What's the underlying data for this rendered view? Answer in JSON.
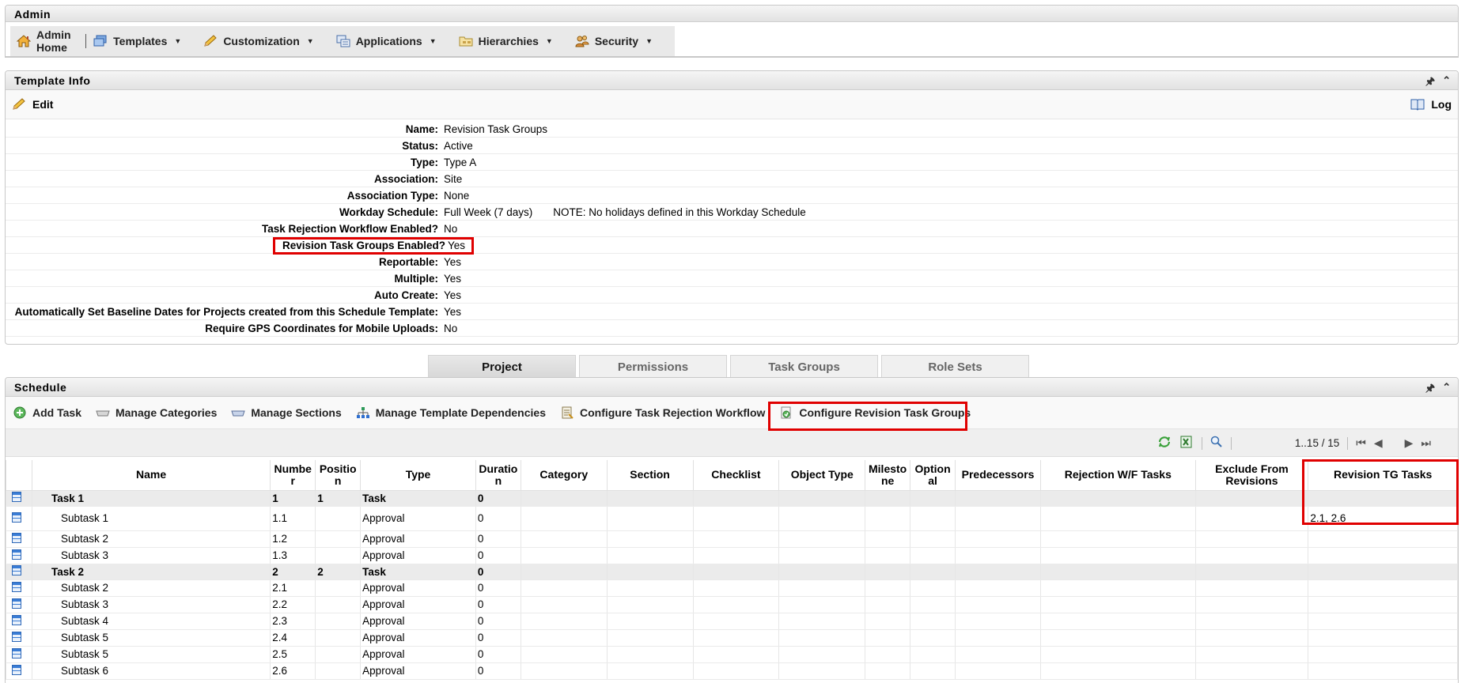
{
  "admin": {
    "title": "Admin",
    "nav": [
      {
        "label": "Admin Home",
        "icon": "house-icon",
        "dropdown": false
      },
      {
        "label": "Templates",
        "icon": "templates-icon",
        "dropdown": true
      },
      {
        "label": "Customization",
        "icon": "pencil-icon",
        "dropdown": true
      },
      {
        "label": "Applications",
        "icon": "applications-icon",
        "dropdown": true
      },
      {
        "label": "Hierarchies",
        "icon": "folder-icon",
        "dropdown": true
      },
      {
        "label": "Security",
        "icon": "users-icon",
        "dropdown": true
      }
    ]
  },
  "template_info": {
    "title": "Template Info",
    "edit_label": "Edit",
    "log_label": "Log",
    "rows": [
      {
        "label": "Name:",
        "value": "Revision Task Groups"
      },
      {
        "label": "Status:",
        "value": "Active"
      },
      {
        "label": "Type:",
        "value": "Type A"
      },
      {
        "label": "Association:",
        "value": "Site"
      },
      {
        "label": "Association Type:",
        "value": "None"
      },
      {
        "label": "Workday Schedule:",
        "value": "Full Week (7 days)",
        "note": "NOTE: No holidays defined in this Workday Schedule"
      },
      {
        "label": "Task Rejection Workflow Enabled?",
        "value": "No"
      },
      {
        "label": "Revision Task Groups Enabled?",
        "value": "Yes",
        "highlighted": true
      },
      {
        "label": "Reportable:",
        "value": "Yes"
      },
      {
        "label": "Multiple:",
        "value": "Yes"
      },
      {
        "label": "Auto Create:",
        "value": "Yes"
      },
      {
        "label": "Automatically Set Baseline Dates for Projects created from this Schedule Template:",
        "value": "Yes"
      },
      {
        "label": "Require GPS Coordinates for Mobile Uploads:",
        "value": "No"
      }
    ]
  },
  "tabs": [
    {
      "label": "Project",
      "active": true
    },
    {
      "label": "Permissions",
      "active": false
    },
    {
      "label": "Task Groups",
      "active": false
    },
    {
      "label": "Role Sets",
      "active": false
    }
  ],
  "schedule": {
    "title": "Schedule",
    "toolbar": [
      {
        "label": "Add Task",
        "icon": "add-icon"
      },
      {
        "label": "Manage Categories",
        "icon": "categories-icon"
      },
      {
        "label": "Manage Sections",
        "icon": "sections-icon"
      },
      {
        "label": "Manage Template Dependencies",
        "icon": "dependencies-icon"
      },
      {
        "label": "Configure Task Rejection Workflow",
        "icon": "rejection-workflow-icon"
      },
      {
        "label": "Configure Revision Task Groups",
        "icon": "revision-groups-icon",
        "highlighted": true
      }
    ],
    "pager_text": "1..15 / 15",
    "columns": [
      "",
      "Name",
      "Numbe r",
      "Positio n",
      "Type",
      "Duratio n",
      "Category",
      "Section",
      "Checklist",
      "Object Type",
      "Milesto ne",
      "Option al",
      "Predecessors",
      "Rejection W/F Tasks",
      "Exclude From Revisions",
      "Revision TG Tasks"
    ],
    "rows": [
      {
        "group": true,
        "name": "Task 1",
        "number": "1",
        "position": "1",
        "type": "Task",
        "duration": "0",
        "revision_tg": ""
      },
      {
        "group": false,
        "name": "Subtask 1",
        "number": "1.1",
        "position": "",
        "type": "Approval",
        "duration": "0",
        "revision_tg": "2.1, 2.6"
      },
      {
        "group": false,
        "name": "Subtask 2",
        "number": "1.2",
        "position": "",
        "type": "Approval",
        "duration": "0",
        "revision_tg": ""
      },
      {
        "group": false,
        "name": "Subtask 3",
        "number": "1.3",
        "position": "",
        "type": "Approval",
        "duration": "0",
        "revision_tg": ""
      },
      {
        "group": true,
        "name": "Task 2",
        "number": "2",
        "position": "2",
        "type": "Task",
        "duration": "0",
        "revision_tg": ""
      },
      {
        "group": false,
        "name": "Subtask 2",
        "number": "2.1",
        "position": "",
        "type": "Approval",
        "duration": "0",
        "revision_tg": ""
      },
      {
        "group": false,
        "name": "Subtask 3",
        "number": "2.2",
        "position": "",
        "type": "Approval",
        "duration": "0",
        "revision_tg": ""
      },
      {
        "group": false,
        "name": "Subtask 4",
        "number": "2.3",
        "position": "",
        "type": "Approval",
        "duration": "0",
        "revision_tg": ""
      },
      {
        "group": false,
        "name": "Subtask 5",
        "number": "2.4",
        "position": "",
        "type": "Approval",
        "duration": "0",
        "revision_tg": ""
      },
      {
        "group": false,
        "name": "Subtask 5",
        "number": "2.5",
        "position": "",
        "type": "Approval",
        "duration": "0",
        "revision_tg": ""
      },
      {
        "group": false,
        "name": "Subtask 6",
        "number": "2.6",
        "position": "",
        "type": "Approval",
        "duration": "0",
        "revision_tg": ""
      }
    ]
  },
  "colors": {
    "highlight": "#e00000",
    "accent": "#2e68b8"
  }
}
